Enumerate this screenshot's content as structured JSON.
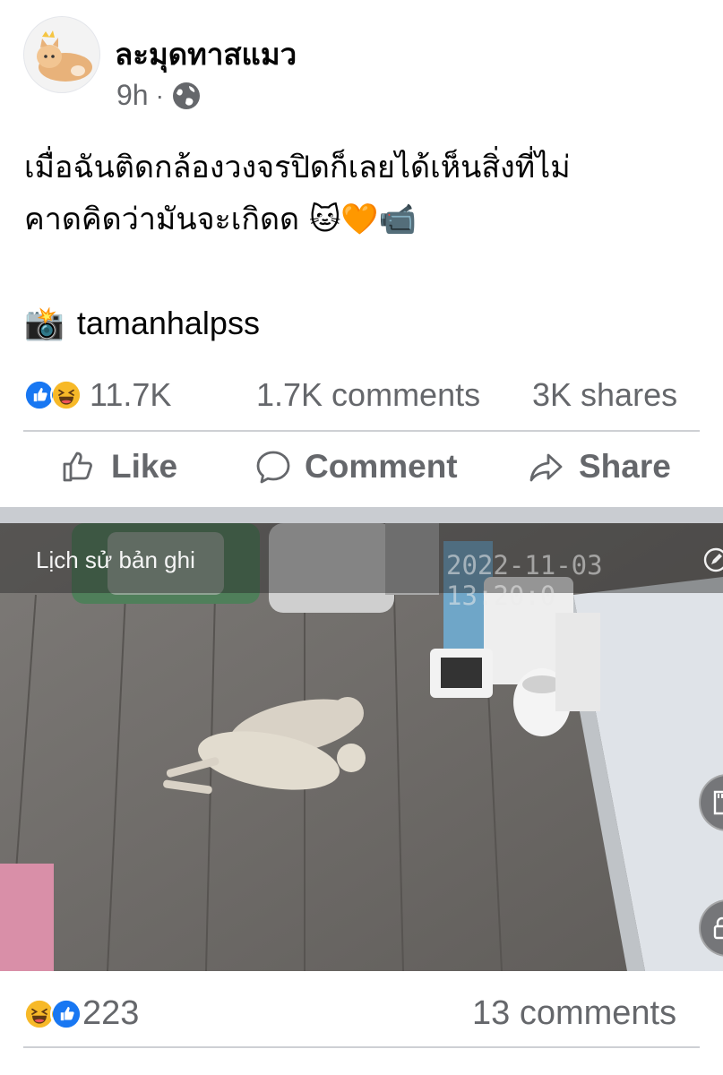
{
  "post": {
    "page_name": "ละมุดทาสแมว",
    "time": "9h",
    "separator": "·",
    "privacy_icon": "globe-icon",
    "text_line1": "เมื่อฉันติดกล้องวงจรปิดก็เลยได้เห็นสิ่งที่ไม่",
    "text_line2": "คาดคิดว่ามันจะเกิดด",
    "text_emojis": "🐱🧡📹",
    "credit_emoji": "📸",
    "credit": "tamanhalpss"
  },
  "stats": {
    "reaction_icons": [
      "like-icon",
      "haha-icon"
    ],
    "reactions": "11.7K",
    "comments": "1.7K comments",
    "shares": "3K shares"
  },
  "actions": {
    "like": "Like",
    "comment": "Comment",
    "share": "Share"
  },
  "media": {
    "record_label": "Lịch sử bản ghi",
    "timestamp": "2022-11-03 13:20:0"
  },
  "stats2": {
    "reaction_icons": [
      "haha-icon",
      "like-icon"
    ],
    "reactions": "223",
    "comments": "13 comments"
  },
  "colors": {
    "like_blue": "#1877f2",
    "haha_yellow": "#f7b928",
    "secondary_text": "#65676b",
    "divider": "#ced0d4"
  }
}
